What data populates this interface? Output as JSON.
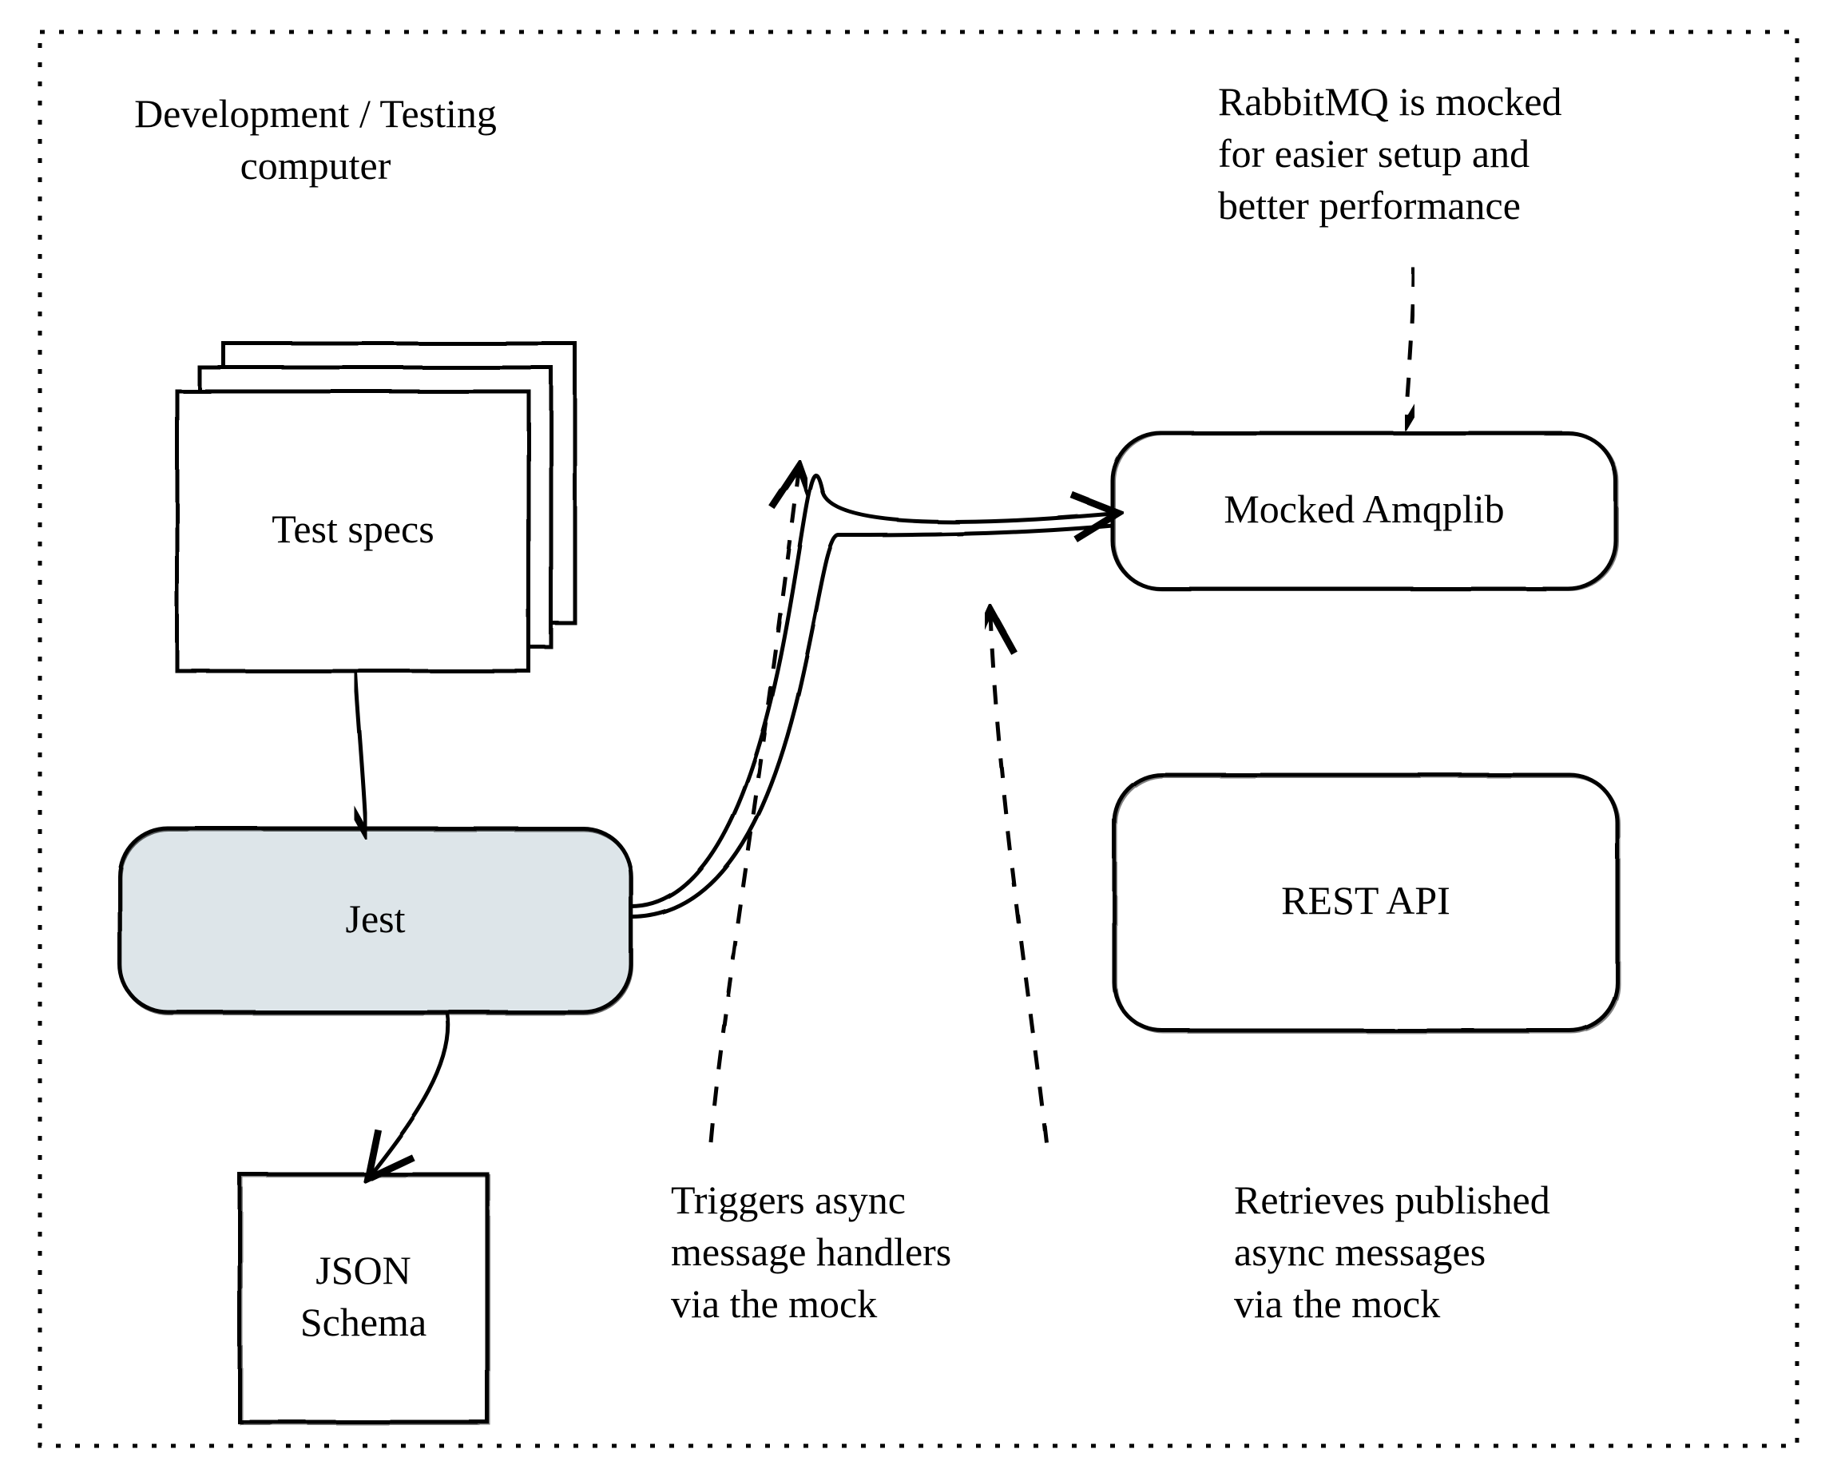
{
  "container_label": "Development / Testing\ncomputer",
  "nodes": {
    "test_specs": "Test specs",
    "jest": "Jest",
    "json_schema": "JSON\nSchema",
    "mocked_amqplib": "Mocked Amqplib",
    "rest_api": "REST API"
  },
  "annotations": {
    "rabbitmq_mocked": "RabbitMQ is mocked\nfor easier setup and\nbetter performance",
    "triggers_async": "Triggers async\nmessage handlers\nvia the mock",
    "retrieves_published": "Retrieves published\nasync messages\nvia the mock"
  }
}
